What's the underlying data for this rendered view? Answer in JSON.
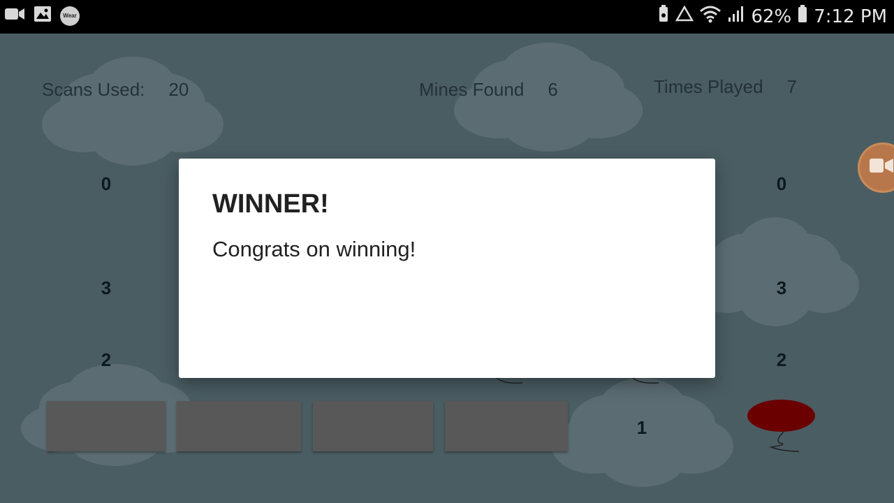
{
  "status_bar": {
    "left_icons": [
      "video-icon",
      "image-icon",
      "wear-icon"
    ],
    "wear_label": "Wear",
    "right_icons": [
      "battery-saver-icon",
      "recycle-icon",
      "wifi-icon",
      "signal-icon",
      "battery-icon"
    ],
    "battery": "62%",
    "time": "7:12 PM"
  },
  "stats": {
    "scans_label": "Scans Used:",
    "scans_value": "20",
    "mines_label": "Mines Found",
    "mines_value": "6",
    "played_label": "Times Played",
    "played_value": "7"
  },
  "grid_numbers": {
    "left_row1": "0",
    "right_row1": "0",
    "left_row2": "3",
    "right_row2": "3",
    "left_row3": "2",
    "right_row3": "2",
    "bottom_number": "1"
  },
  "dialog": {
    "title": "WINNER!",
    "message": "Congrats on winning!"
  },
  "colors": {
    "background": "#4a5d63",
    "balloon": "#6a0000",
    "record_button": "#b8774a",
    "tile": "#585858"
  }
}
